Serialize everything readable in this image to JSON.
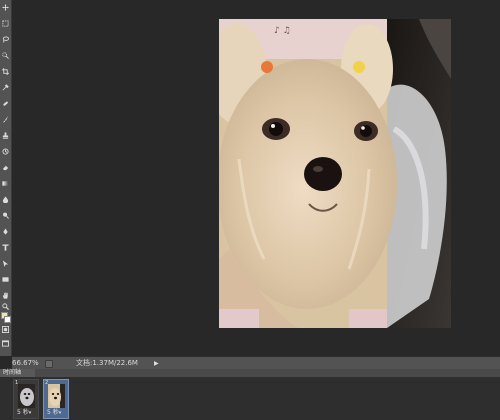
{
  "statusbar": {
    "zoom": "66.67%",
    "doc_size": "文档:1.37M/22.6M",
    "arrow": "▶"
  },
  "timeline": {
    "tab_label": "时间轴",
    "frames": [
      {
        "number": "1",
        "delay": "5 秒",
        "selected": false
      },
      {
        "number": "2",
        "delay": "5 秒",
        "selected": true
      }
    ]
  },
  "toolbar": {
    "icons": [
      "move-icon",
      "marquee-icon",
      "lasso-icon",
      "quick-select-icon",
      "crop-icon",
      "eyedropper-icon",
      "healing-brush-icon",
      "brush-icon",
      "clone-stamp-icon",
      "history-brush-icon",
      "eraser-icon",
      "gradient-icon",
      "blur-icon",
      "dodge-icon",
      "pen-icon",
      "type-icon",
      "path-select-icon",
      "rectangle-icon",
      "hand-icon",
      "zoom-icon"
    ],
    "foreground_color": "#f2e6a8",
    "background_color": "#ffffff"
  },
  "document": {
    "image": "dog-photo"
  },
  "colors": {
    "panel": "#535353",
    "canvas": "#282828",
    "selected_frame": "#4f6a90"
  }
}
